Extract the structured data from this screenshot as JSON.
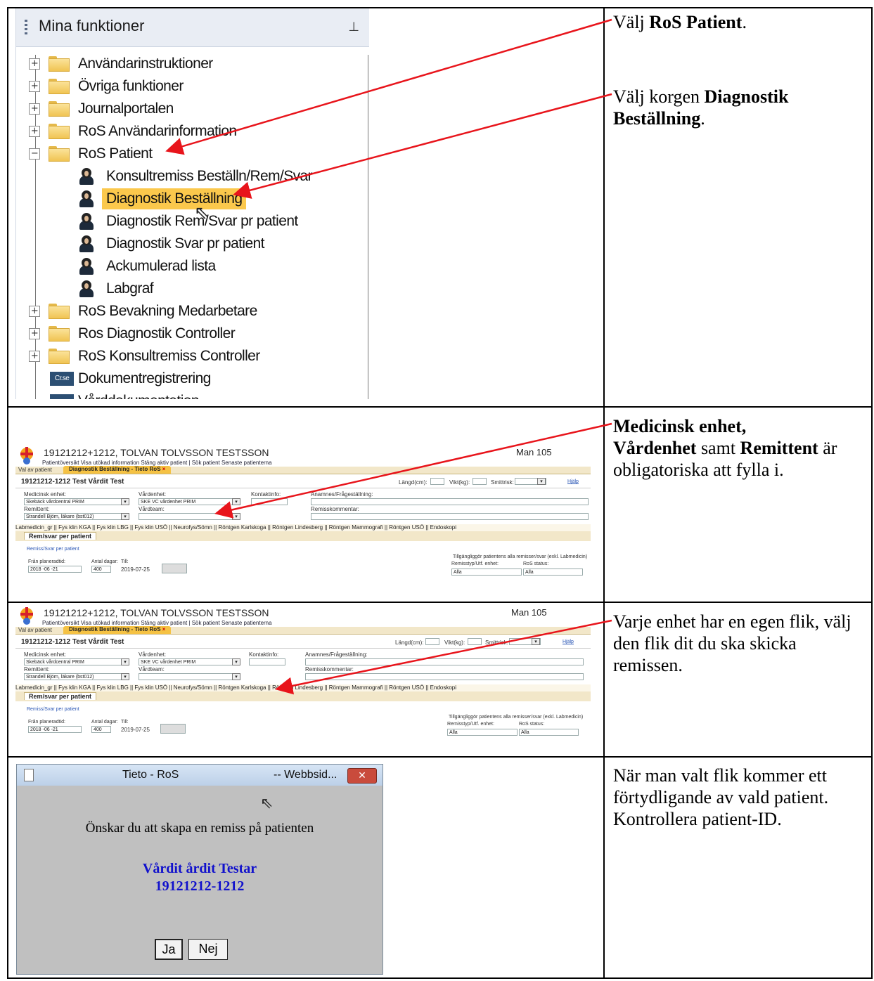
{
  "tree": {
    "title": "Mina funktioner",
    "pin_icon": "pin-icon",
    "items": [
      {
        "label": "Användarinstruktioner",
        "kind": "folder",
        "expander": "+"
      },
      {
        "label": "Övriga funktioner",
        "kind": "folder",
        "expander": "+"
      },
      {
        "label": "Journalportalen",
        "kind": "folder",
        "expander": "+"
      },
      {
        "label": "RoS Användarinformation",
        "kind": "folder",
        "expander": "+"
      },
      {
        "label": "RoS Patient",
        "kind": "folder",
        "expander": "−"
      },
      {
        "label": "Konsultremiss Beställn/Rem/Svar",
        "kind": "person"
      },
      {
        "label": "Diagnostik Beställning",
        "kind": "person",
        "selected": true
      },
      {
        "label": "Diagnostik Rem/Svar pr patient",
        "kind": "person"
      },
      {
        "label": "Diagnostik Svar pr patient",
        "kind": "person"
      },
      {
        "label": "Ackumulerad lista",
        "kind": "person"
      },
      {
        "label": "Labgraf",
        "kind": "person"
      },
      {
        "label": "RoS Bevakning Medarbetare",
        "kind": "folder",
        "expander": "+"
      },
      {
        "label": "Ros Diagnostik Controller",
        "kind": "folder",
        "expander": "+"
      },
      {
        "label": "RoS Konsultremiss Controller",
        "kind": "folder",
        "expander": "+"
      },
      {
        "label": "Dokumentregistrering",
        "kind": "doc",
        "icon_text": "Cr.se"
      },
      {
        "label": "Vårddokumentation",
        "kind": "doc",
        "icon_text": ""
      }
    ]
  },
  "instructions": {
    "i1": {
      "pre": "Välj ",
      "bold": "RoS Patient",
      "post": "."
    },
    "i2": {
      "pre": "Välj korgen ",
      "bold": "Diagnostik Beställning",
      "post": "."
    },
    "i3": {
      "bold1": "Medicinsk enhet,",
      "bold2": "Vårdenhet",
      "mid": " samt ",
      "bold3": "Remittent",
      "post": " är obligatoriska att fylla i."
    },
    "i4": "Varje enhet har en egen flik, välj den flik dit du ska skicka remissen.",
    "i5": "När man valt flik kommer ett förtydligande av vald patient. Kontrollera patient-ID."
  },
  "form": {
    "patient_header": "19121212+1212, TOLVAN TOLVSSON TESTSSON",
    "room": "Man 105",
    "tools": "Patientöversikt   Visa utökad information   Stäng aktiv patient   |   Sök patient   Senaste patienterna",
    "tab_val": "Val av patient",
    "tab_active": "Diagnostik Beställning - Tieto RoS",
    "tab_close": "×",
    "patient_row": "19121212-1212  Test Vårdit Test",
    "langd_label": "Längd(cm):",
    "vikt_label": "Vikt(kg):",
    "smitt_label": "Smittrisk:",
    "hjalp": "Hjälp",
    "med_label": "Medicinsk enhet:",
    "med_value": "Skebäck vårdcentral PRIM",
    "vard_label": "Vårdenhet:",
    "vard_value": "SKE VC vårdenhet PRIM",
    "kontakt_label": "Kontaktinfo:",
    "anamnes_label": "Anamnes/Frågeställning:",
    "remittent_label": "Remittent:",
    "remittent_value": "Strandell Björn, läkare (bst012)",
    "vardteam_label": "Vårdteam:",
    "remisskommentar_label": "Remisskommentar:",
    "lab_tabs": "Labmedicin_gr || Fys klin KGA || Fys klin LBG || Fys klin USÖ || Neurofys/Sömn || Röntgen Karlskoga || Röntgen Lindesberg || Röntgen Mammografi || Röntgen USÖ || Endoskopi",
    "rem_tab": "Rem/svar per patient",
    "rem_link": "Remiss/Svar per patient",
    "fran_label": "Från planeradtid:",
    "fran_value": "2018 -06 -21",
    "antal_label": "Antal dagar:",
    "antal_value": "400",
    "till_label": "Till:",
    "till_value": "2019-07-25",
    "tillgang": "Tillgängliggör patientens alla remisser/svar (exkl. Labmedicin)",
    "remisstyp_label": "Remisstyp/Utf. enhet:",
    "remisstyp_value": "Alla",
    "ros_status_label": "RoS status:",
    "ros_status_value": "Alla"
  },
  "dialog": {
    "title": "Tieto - RoS",
    "title_suffix": "-- Webbsid...",
    "close": "✕",
    "question": "Önskar du att skapa en remiss på patienten",
    "name": "Vårdit årdit Testar",
    "pid": "19121212-1212",
    "yes": "Ja",
    "no": "Nej"
  },
  "colors": {
    "arrow": "#e8141b",
    "selected": "#fbc84c",
    "dialog_name": "#1111cc"
  }
}
